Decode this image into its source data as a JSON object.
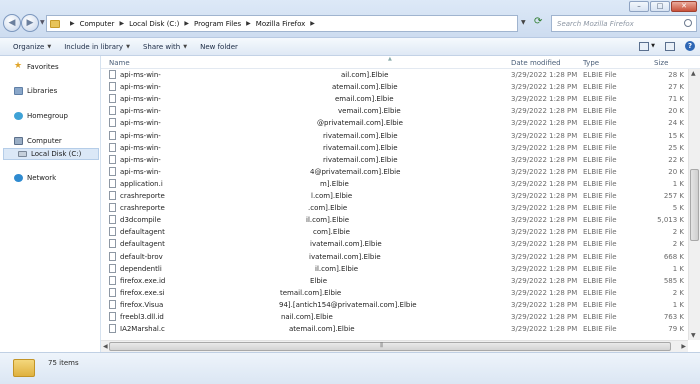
{
  "address_bar": {
    "crumbs": [
      "Computer",
      "Local Disk (C:)",
      "Program Files",
      "Mozilla Firefox"
    ],
    "search_placeholder": "Search Mozilla Firefox"
  },
  "commands": {
    "organize": "Organize",
    "include_in_library": "Include in library",
    "share_with": "Share with",
    "new_folder": "New folder"
  },
  "nav": {
    "favorites": "Favorites",
    "libraries": "Libraries",
    "homegroup": "Homegroup",
    "computer": "Computer",
    "local_disk": "Local Disk (C:)",
    "network": "Network"
  },
  "columns": {
    "name": "Name",
    "date_modified": "Date modified",
    "type": "Type",
    "size": "Size"
  },
  "files": [
    {
      "name": "api-ms-win-",
      "tail": "ail.com].Elbie",
      "date": "3/29/2022 1:28 PM",
      "type": "ELBIE File",
      "size": "28 K"
    },
    {
      "name": "api-ms-win-",
      "tail": "atemail.com].Elbie",
      "date": "3/29/2022 1:28 PM",
      "type": "ELBIE File",
      "size": "27 K"
    },
    {
      "name": "api-ms-win-",
      "tail": "email.com].Elbie",
      "date": "3/29/2022 1:28 PM",
      "type": "ELBIE File",
      "size": "71 K"
    },
    {
      "name": "api-ms-win-",
      "tail": "vemail.com].Elbie",
      "date": "3/29/2022 1:28 PM",
      "type": "ELBIE File",
      "size": "20 K"
    },
    {
      "name": "api-ms-win-",
      "tail": "@privatemail.com].Elbie",
      "date": "3/29/2022 1:28 PM",
      "type": "ELBIE File",
      "size": "24 K"
    },
    {
      "name": "api-ms-win-",
      "tail": "rivatemail.com].Elbie",
      "date": "3/29/2022 1:28 PM",
      "type": "ELBIE File",
      "size": "15 K"
    },
    {
      "name": "api-ms-win-",
      "tail": "rivatemail.com].Elbie",
      "date": "3/29/2022 1:28 PM",
      "type": "ELBIE File",
      "size": "25 K"
    },
    {
      "name": "api-ms-win-",
      "tail": "rivatemail.com].Elbie",
      "date": "3/29/2022 1:28 PM",
      "type": "ELBIE File",
      "size": "22 K"
    },
    {
      "name": "api-ms-win-",
      "tail": "4@privatemail.com].Elbie",
      "date": "3/29/2022 1:28 PM",
      "type": "ELBIE File",
      "size": "20 K"
    },
    {
      "name": "application.i",
      "tail": "m].Elbie",
      "date": "3/29/2022 1:28 PM",
      "type": "ELBIE File",
      "size": "1 K"
    },
    {
      "name": "crashreporte",
      "tail": "l.com].Elbie",
      "date": "3/29/2022 1:28 PM",
      "type": "ELBIE File",
      "size": "257 K"
    },
    {
      "name": "crashreporte",
      "tail": ".com].Elbie",
      "date": "3/29/2022 1:28 PM",
      "type": "ELBIE File",
      "size": "5 K"
    },
    {
      "name": "d3dcompile",
      "tail": "il.com].Elbie",
      "date": "3/29/2022 1:28 PM",
      "type": "ELBIE File",
      "size": "5,013 K"
    },
    {
      "name": "defaultagent",
      "tail": "com].Elbie",
      "date": "3/29/2022 1:28 PM",
      "type": "ELBIE File",
      "size": "2 K"
    },
    {
      "name": "defaultagent",
      "tail": "ivatemail.com].Elbie",
      "date": "3/29/2022 1:28 PM",
      "type": "ELBIE File",
      "size": "2 K"
    },
    {
      "name": "default-brov",
      "tail": "ivatemail.com].Elbie",
      "date": "3/29/2022 1:28 PM",
      "type": "ELBIE File",
      "size": "668 K"
    },
    {
      "name": "dependentli",
      "tail": "il.com].Elbie",
      "date": "3/29/2022 1:28 PM",
      "type": "ELBIE File",
      "size": "1 K"
    },
    {
      "name": "firefox.exe.id",
      "tail": "Elbie",
      "date": "3/29/2022 1:28 PM",
      "type": "ELBIE File",
      "size": "585 K"
    },
    {
      "name": "firefox.exe.si",
      "tail": "temail.com].Elbie",
      "date": "3/29/2022 1:28 PM",
      "type": "ELBIE File",
      "size": "2 K"
    },
    {
      "name": "firefox.Visua",
      "tail": "94].[antich154@privatemail.com].Elbie",
      "date": "3/29/2022 1:28 PM",
      "type": "ELBIE File",
      "size": "1 K"
    },
    {
      "name": "freebl3.dll.id",
      "tail": "nail.com].Elbie",
      "date": "3/29/2022 1:28 PM",
      "type": "ELBIE File",
      "size": "763 K"
    },
    {
      "name": "IA2Marshal.c",
      "tail": "atemail.com].Elbie",
      "date": "3/29/2022 1:28 PM",
      "type": "ELBIE File",
      "size": "79 K"
    }
  ],
  "status": {
    "item_count": "75 items"
  }
}
